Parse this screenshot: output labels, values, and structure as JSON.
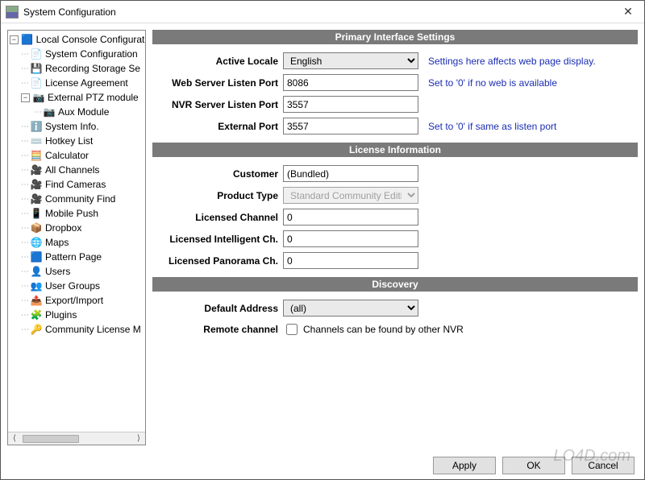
{
  "window": {
    "title": "System Configuration"
  },
  "tree": {
    "root": {
      "label": "Local Console Configurati",
      "icon": "🟦",
      "expanded": true
    },
    "items": [
      {
        "label": "System Configuration",
        "icon": "📄",
        "indent": 1
      },
      {
        "label": "Recording Storage Se",
        "icon": "💾",
        "indent": 1
      },
      {
        "label": "License Agreement",
        "icon": "📄",
        "indent": 1
      },
      {
        "label": "External PTZ module",
        "icon": "📷",
        "indent": 1,
        "expandable": true,
        "expanded": true
      },
      {
        "label": "Aux Module",
        "icon": "📷",
        "indent": 2
      },
      {
        "label": "System Info.",
        "icon": "ℹ️",
        "indent": 1
      },
      {
        "label": "Hotkey List",
        "icon": "⌨️",
        "indent": 1
      },
      {
        "label": "Calculator",
        "icon": "🧮",
        "indent": 1
      },
      {
        "label": "All Channels",
        "icon": "🎥",
        "indent": 1
      },
      {
        "label": "Find Cameras",
        "icon": "🎥",
        "indent": 1
      },
      {
        "label": "Community Find",
        "icon": "🎥",
        "indent": 1
      },
      {
        "label": "Mobile Push",
        "icon": "📱",
        "indent": 1
      },
      {
        "label": "Dropbox",
        "icon": "📦",
        "indent": 1
      },
      {
        "label": "Maps",
        "icon": "🌐",
        "indent": 1
      },
      {
        "label": "Pattern Page",
        "icon": "🟦",
        "indent": 1
      },
      {
        "label": "Users",
        "icon": "👤",
        "indent": 1
      },
      {
        "label": "User Groups",
        "icon": "👥",
        "indent": 1
      },
      {
        "label": "Export/Import",
        "icon": "📤",
        "indent": 1
      },
      {
        "label": "Plugins",
        "icon": "🧩",
        "indent": 1
      },
      {
        "label": "Community License M",
        "icon": "🔑",
        "indent": 1
      }
    ]
  },
  "sections": {
    "primary": {
      "title": "Primary Interface Settings",
      "active_locale_label": "Active Locale",
      "active_locale_value": "English",
      "active_locale_hint": "Settings here affects web page display.",
      "web_port_label": "Web Server Listen Port",
      "web_port_value": "8086",
      "web_port_hint": "Set to '0' if no web is available",
      "nvr_port_label": "NVR Server Listen Port",
      "nvr_port_value": "3557",
      "ext_port_label": "External Port",
      "ext_port_value": "3557",
      "ext_port_hint": "Set to '0' if same as listen port"
    },
    "license": {
      "title": "License Information",
      "customer_label": "Customer",
      "customer_value": "(Bundled)",
      "product_type_label": "Product Type",
      "product_type_value": "Standard Community Edition",
      "licensed_channel_label": "Licensed Channel",
      "licensed_channel_value": "0",
      "licensed_intel_label": "Licensed Intelligent Ch.",
      "licensed_intel_value": "0",
      "licensed_pano_label": "Licensed Panorama Ch.",
      "licensed_pano_value": "0"
    },
    "discovery": {
      "title": "Discovery",
      "default_addr_label": "Default Address",
      "default_addr_value": "(all)",
      "remote_channel_label": "Remote channel",
      "remote_channel_checkbox": "Channels can be found by other NVR",
      "remote_channel_checked": false
    }
  },
  "footer": {
    "apply": "Apply",
    "ok": "OK",
    "cancel": "Cancel"
  },
  "watermark": "LO4D.com"
}
